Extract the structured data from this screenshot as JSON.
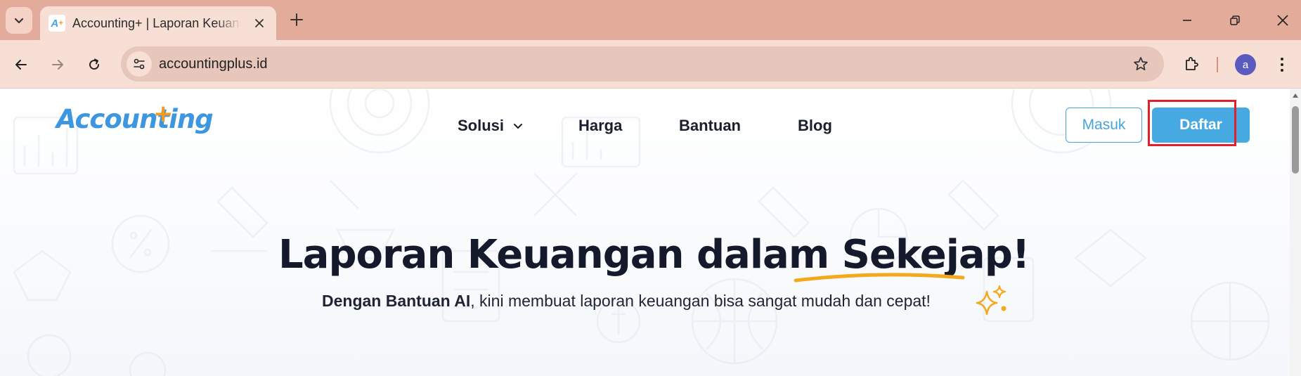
{
  "browser": {
    "tab": {
      "favicon_text": "A",
      "favicon_plus": "+",
      "title": "Accounting+ | Laporan Keuangan"
    },
    "address_bar": {
      "url": "accountingplus.id"
    },
    "profile": {
      "initial": "a"
    }
  },
  "site": {
    "logo": {
      "text": "Accounting",
      "plus": "+"
    },
    "nav": {
      "items": [
        {
          "label": "Solusi",
          "has_dropdown": true
        },
        {
          "label": "Harga"
        },
        {
          "label": "Bantuan"
        },
        {
          "label": "Blog"
        }
      ]
    },
    "auth": {
      "login_label": "Masuk",
      "register_label": "Daftar"
    },
    "hero": {
      "title_main": "Laporan Keuangan dalam ",
      "title_accent": "Sekejap!",
      "subtitle_bold": "Dengan Bantuan AI",
      "subtitle_rest": ", kini membuat laporan keuangan bisa sangat mudah dan cepat!"
    }
  },
  "colors": {
    "titlebar": "#e3ab9a",
    "toolbar": "#f8dfd5",
    "brand_blue": "#46a9e2",
    "brand_orange": "#f29a1c",
    "highlight": "#e0202a",
    "heading": "#141a2b"
  }
}
